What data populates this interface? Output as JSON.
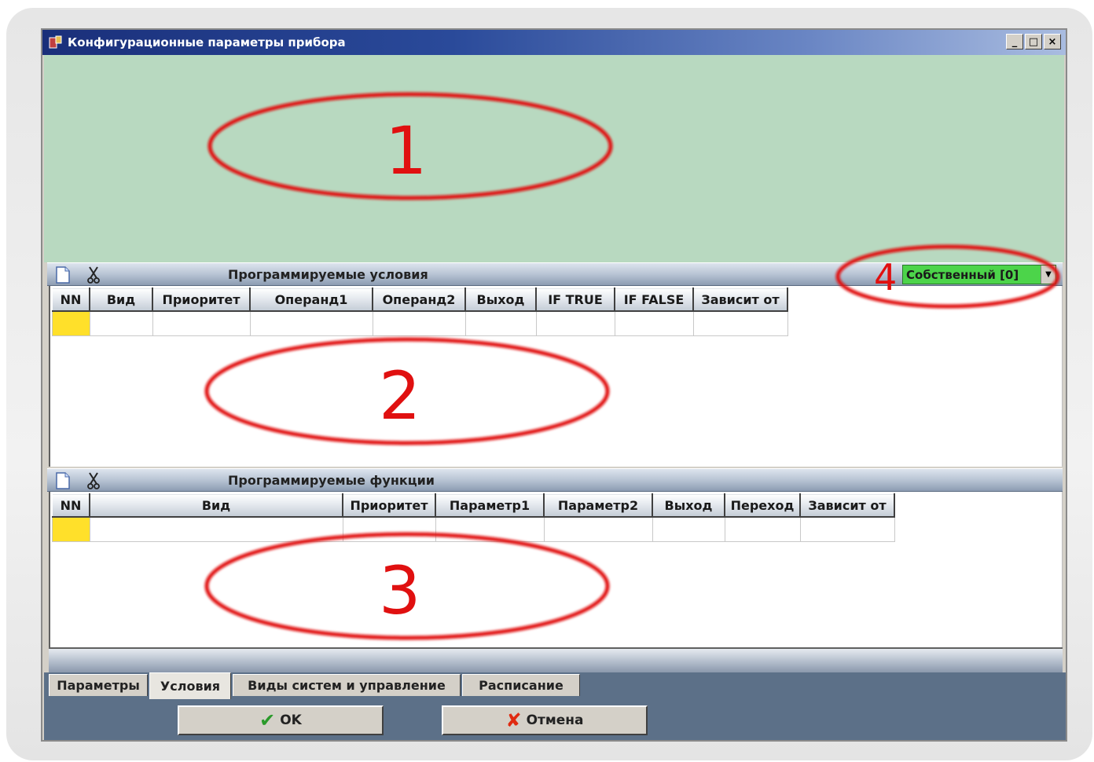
{
  "window": {
    "title": "Конфигурационные параметры прибора",
    "minimize_label": "_",
    "maximize_label": "□",
    "close_label": "×"
  },
  "annotations": {
    "n1": "1",
    "n2": "2",
    "n3": "3",
    "n4": "4",
    "color": "#e01010"
  },
  "conditions": {
    "title": "Программируемые условия",
    "mode_selected": "Собственный [0]",
    "columns": [
      "NN",
      "Вид",
      "Приоритет",
      "Операнд1",
      "Операнд2",
      "Выход",
      "IF TRUE",
      "IF FALSE",
      "Зависит от"
    ]
  },
  "functions": {
    "title": "Программируемые функции",
    "columns": [
      "NN",
      "Вид",
      "Приоритет",
      "Параметр1",
      "Параметр2",
      "Выход",
      "Переход",
      "Зависит от"
    ]
  },
  "tabs": [
    "Параметры",
    "Условия",
    "Виды систем и управление",
    "Расписание"
  ],
  "active_tab": "Условия",
  "buttons": {
    "ok_label": "OK",
    "cancel_label": "Отмена"
  },
  "colors": {
    "config_area": "#b8d9c0",
    "selector_bg": "#4cd44a",
    "nn_cell": "#ffe02a",
    "footer": "#5c7088"
  },
  "icons": [
    "new-document-icon",
    "scissors-icon",
    "check-icon",
    "x-icon"
  ]
}
